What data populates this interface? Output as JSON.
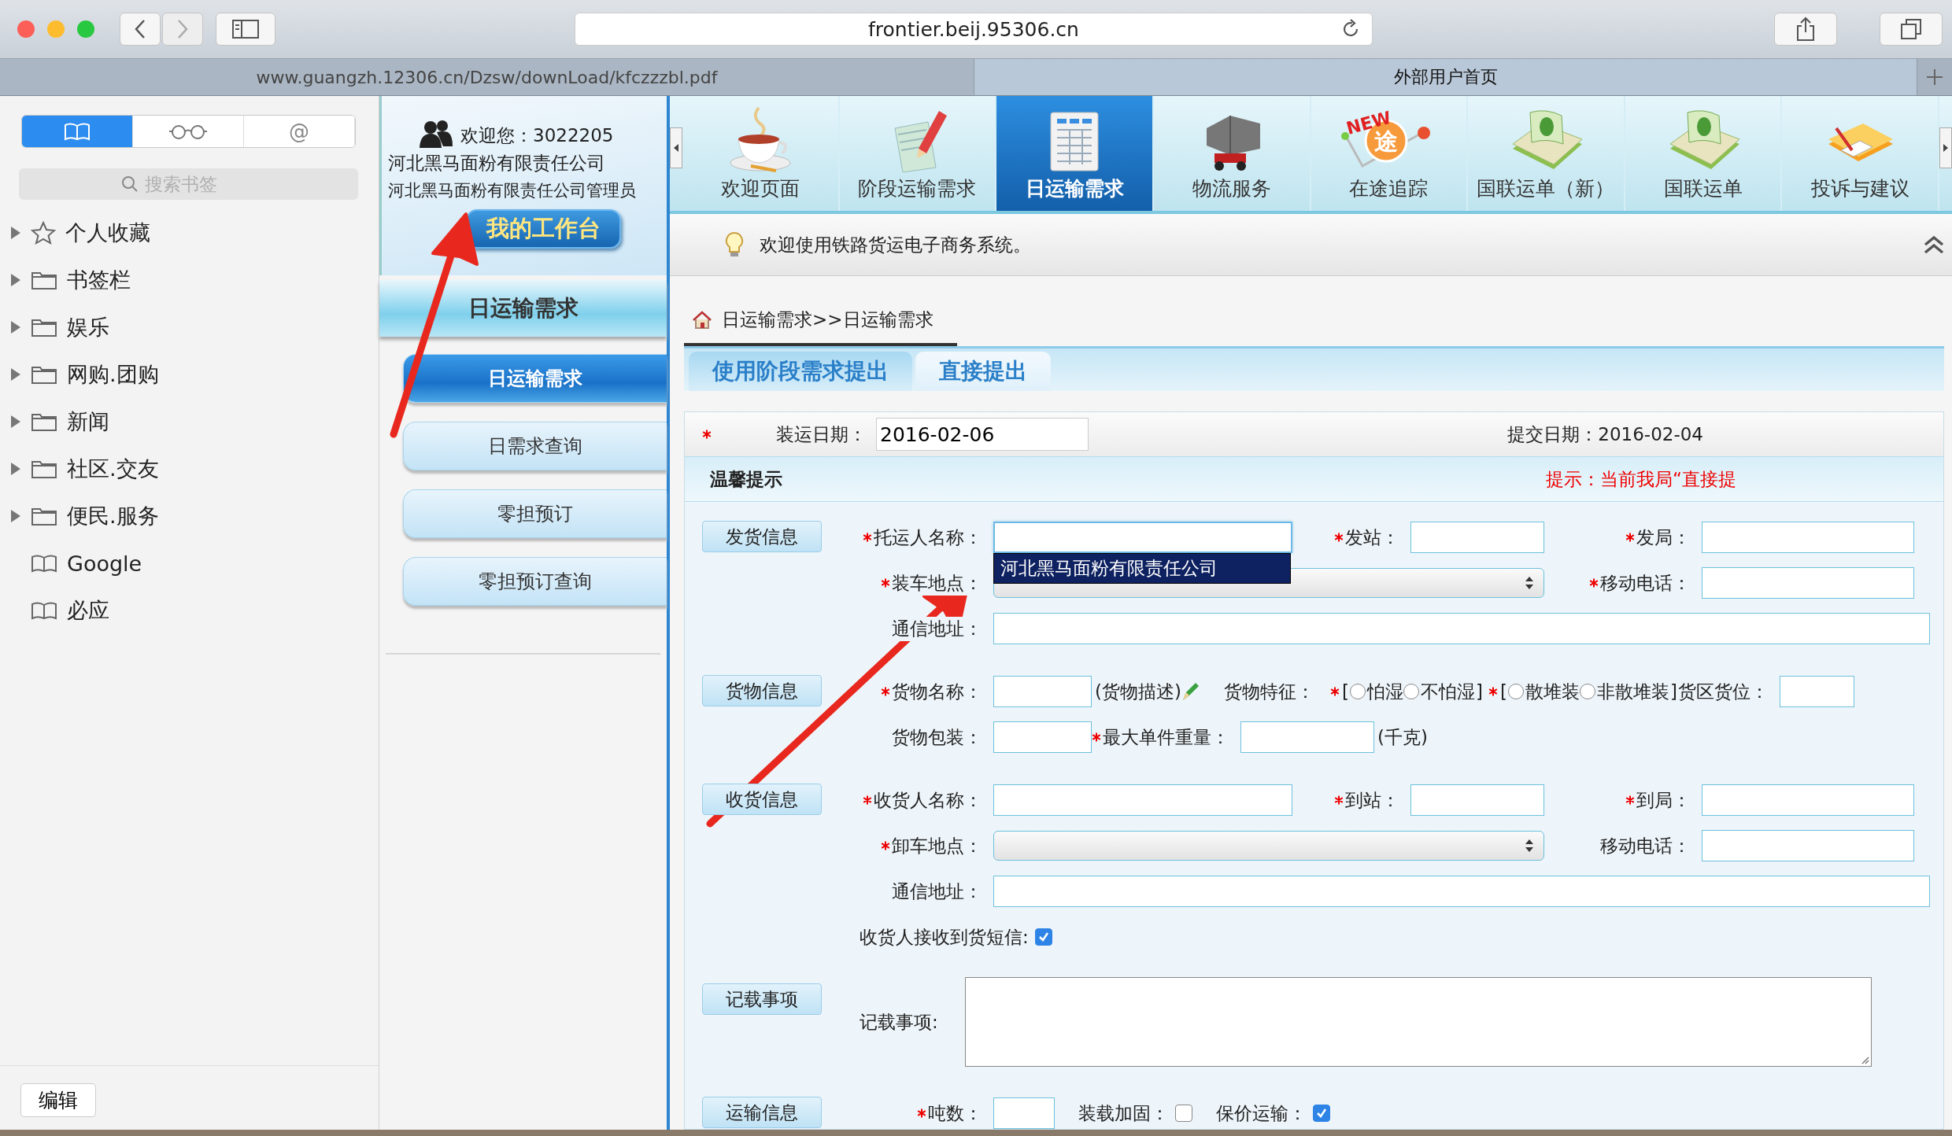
{
  "browser": {
    "address": "frontier.beij.95306.cn",
    "tabs": [
      {
        "label": "www.guangzh.12306.cn/Dzsw/downLoad/kfczzzbl.pdf",
        "selected": false
      },
      {
        "label": "外部用户首页",
        "selected": true
      }
    ]
  },
  "sidebar": {
    "segments": [
      {
        "kind": "book",
        "selected": true
      },
      {
        "kind": "glasses",
        "selected": false
      },
      {
        "kind": "at",
        "label": "@",
        "selected": false
      }
    ],
    "search": {
      "placeholder": "搜索书签"
    },
    "items": [
      {
        "kind": "favorites",
        "label": "个人收藏"
      },
      {
        "kind": "folder",
        "label": "书签栏"
      },
      {
        "kind": "folder",
        "label": "娱乐"
      },
      {
        "kind": "folder",
        "label": "网购.团购"
      },
      {
        "kind": "folder",
        "label": "新闻"
      },
      {
        "kind": "folder",
        "label": "社区.交友"
      },
      {
        "kind": "folder",
        "label": "便民.服务"
      },
      {
        "kind": "bookmark",
        "label": "Google"
      },
      {
        "kind": "bookmark",
        "label": "必应"
      }
    ],
    "edit_button": "编辑"
  },
  "user": {
    "welcome": "欢迎您：3022205",
    "company": "河北黑马面粉有限责任公司",
    "role": "河北黑马面粉有限责任公司管理员",
    "workbench_button": "我的工作台"
  },
  "menu": {
    "title": "日运输需求",
    "items": [
      {
        "label": "日运输需求",
        "selected": true
      },
      {
        "label": "日需求查询",
        "selected": false
      },
      {
        "label": "零担预订",
        "selected": false
      },
      {
        "label": "零担预订查询",
        "selected": false
      }
    ]
  },
  "nav": [
    {
      "kind": "coffee",
      "label": "欢迎页面",
      "selected": false
    },
    {
      "kind": "document",
      "label": "阶段运输需求",
      "selected": false
    },
    {
      "kind": "table",
      "label": "日运输需求",
      "selected": true
    },
    {
      "kind": "truck",
      "label": "物流服务",
      "selected": false
    },
    {
      "kind": "route",
      "label": "在途追踪",
      "badge": "NEW",
      "icon_text": "途",
      "selected": false
    },
    {
      "kind": "money",
      "label": "国联运单（新）",
      "selected": false
    },
    {
      "kind": "money",
      "label": "国联运单",
      "selected": false
    },
    {
      "kind": "folder",
      "label": "投诉与建议",
      "selected": false
    }
  ],
  "notice": "欢迎使用铁路货运电子商务系统。",
  "breadcrumb": "日运输需求>>日运输需求",
  "form_tabs": [
    {
      "label": "使用阶段需求提出",
      "selected": false
    },
    {
      "label": "直接提出",
      "selected": true
    }
  ],
  "form": {
    "date": {
      "required": true,
      "label": "装运日期：",
      "value": "2016-02-06"
    },
    "submit_date": "提交日期：2016-02-04",
    "tip": {
      "title": "温馨提示",
      "text": "提示：当前我局“直接提"
    },
    "sections": [
      {
        "label": "发货信息",
        "rows": [
          [
            {
              "kind": "text",
              "label": "托运人名称：",
              "required": true,
              "suggestion": "河北黑马面粉有限责任公司"
            },
            {
              "kind": "text",
              "label": "发站：",
              "required": true
            },
            {
              "kind": "text",
              "label": "发局：",
              "required": true
            }
          ],
          [
            {
              "kind": "select",
              "label": "装车地点：",
              "required": true
            },
            "",
            {
              "kind": "text",
              "label": "移动电话：",
              "required": true
            }
          ],
          [
            {
              "kind": "long-text",
              "label": "通信地址：",
              "required": false
            }
          ]
        ]
      },
      {
        "label": "货物信息",
        "rows": [
          [
            {
              "kind": "short-text",
              "label": "货物名称：",
              "required": true,
              "note": "(货物描述)"
            },
            {
              "kind": "radio-group",
              "label": "货物特征：",
              "groups": [
                {
                  "required": true,
                  "open": "[",
                  "close": "]",
                  "options": [
                    {
                      "label": "怕湿",
                      "selected": false
                    },
                    {
                      "label": "不怕湿",
                      "selected": false
                    }
                  ]
                },
                {
                  "required": true,
                  "open": "[",
                  "close": "]",
                  "options": [
                    {
                      "label": "散堆装",
                      "selected": false
                    },
                    {
                      "label": "非散堆装",
                      "selected": false
                    }
                  ]
                }
              ]
            },
            {
              "kind": "small-text",
              "label": "货区货位：",
              "required": false
            }
          ],
          [
            {
              "kind": "short-text",
              "label": "货物包装：",
              "required": false
            },
            {
              "kind": "text",
              "label": "最大单件重量：",
              "required": true,
              "unit": "(千克)"
            }
          ]
        ]
      },
      {
        "label": "收货信息",
        "rows": [
          [
            {
              "kind": "text",
              "label": "收货人名称：",
              "required": true
            },
            {
              "kind": "text",
              "label": "到站：",
              "required": true
            },
            {
              "kind": "text",
              "label": "到局：",
              "required": true
            }
          ],
          [
            {
              "kind": "select",
              "label": "卸车地点：",
              "required": true
            },
            "",
            {
              "kind": "text",
              "label": "移动电话：",
              "required": false
            }
          ],
          [
            {
              "kind": "long-text",
              "label": "通信地址：",
              "required": false
            }
          ],
          [
            {
              "kind": "checkbox",
              "label": "收货人接收到货短信:",
              "checked": true
            }
          ]
        ]
      },
      {
        "label": "记载事项",
        "rows": [
          [
            {
              "kind": "textarea",
              "label": "记载事项:"
            }
          ]
        ]
      },
      {
        "label": "运输信息",
        "rows": [
          [
            {
              "kind": "tiny-text",
              "label": "吨数：",
              "required": true
            },
            {
              "kind": "checkbox",
              "label": "装载加固：",
              "checked": false
            },
            {
              "kind": "checkbox",
              "label": "保价运输：",
              "checked": true
            }
          ]
        ]
      }
    ]
  }
}
